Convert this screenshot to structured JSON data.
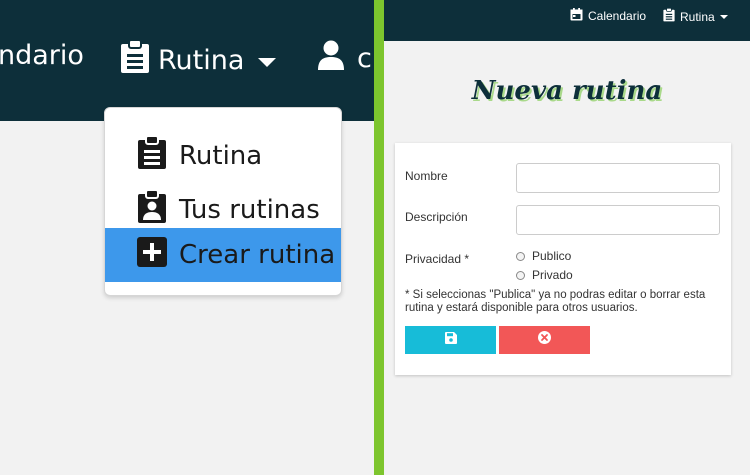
{
  "left_nav": {
    "calendar_label": "ndario",
    "rutina_label": "Rutina",
    "user_label": "c"
  },
  "dropdown": {
    "items": [
      {
        "label": "Rutina",
        "icon": "clipboard-list-icon"
      },
      {
        "label": "Tus rutinas",
        "icon": "clipboard-user-icon"
      },
      {
        "label": "Crear rutina",
        "icon": "plus-square-icon",
        "active": true
      }
    ]
  },
  "right_nav": {
    "calendar_label": "Calendario",
    "rutina_label": "Rutina"
  },
  "page": {
    "title": "Nueva rutina"
  },
  "form": {
    "nombre_label": "Nombre",
    "nombre_value": "",
    "descripcion_label": "Descripción",
    "descripcion_value": "",
    "privacidad_label": "Privacidad *",
    "privacy_options": [
      "Publico",
      "Privado"
    ],
    "note": "* Si seleccionas \"Publica\" ya no podras editar o borrar esta rutina y estará disponible para otros usuarios.",
    "save_icon": "floppy-disk-icon",
    "cancel_icon": "times-circle-icon"
  },
  "colors": {
    "navbar": "#0d2f3a",
    "divider": "#7dc52e",
    "active_item": "#3d98eb",
    "save_button": "#17bcd8",
    "cancel_button": "#f25757"
  }
}
